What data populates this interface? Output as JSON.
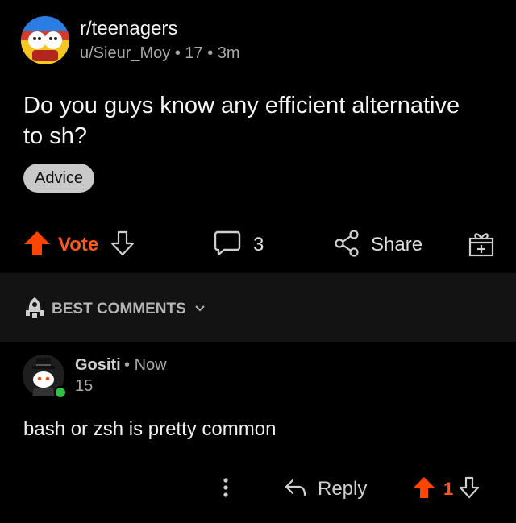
{
  "post": {
    "subreddit": "r/teenagers",
    "author": "u/Sieur_Moy",
    "author_flair": "17",
    "age": "3m",
    "title": "Do you guys know any efficient alternative to sh?",
    "flair": "Advice"
  },
  "actions": {
    "vote_label": "Vote",
    "comment_count": "3",
    "share_label": "Share"
  },
  "comments_section": {
    "sort_label": "BEST COMMENTS"
  },
  "comment": {
    "author": "Gositi",
    "age": "Now",
    "flair": "15",
    "body": "bash or zsh is pretty common",
    "reply_label": "Reply",
    "score": "1"
  },
  "colors": {
    "background": "#000000",
    "accent_orange": "#ff5a1f",
    "section_bg": "#131313",
    "online_green": "#2fc246",
    "flair_bg": "#c9c9c9"
  },
  "icons": [
    "upvote-icon",
    "downvote-icon",
    "comment-icon",
    "share-icon",
    "award-icon",
    "sort-icon",
    "chevron-down-icon",
    "more-icon",
    "reply-icon"
  ]
}
